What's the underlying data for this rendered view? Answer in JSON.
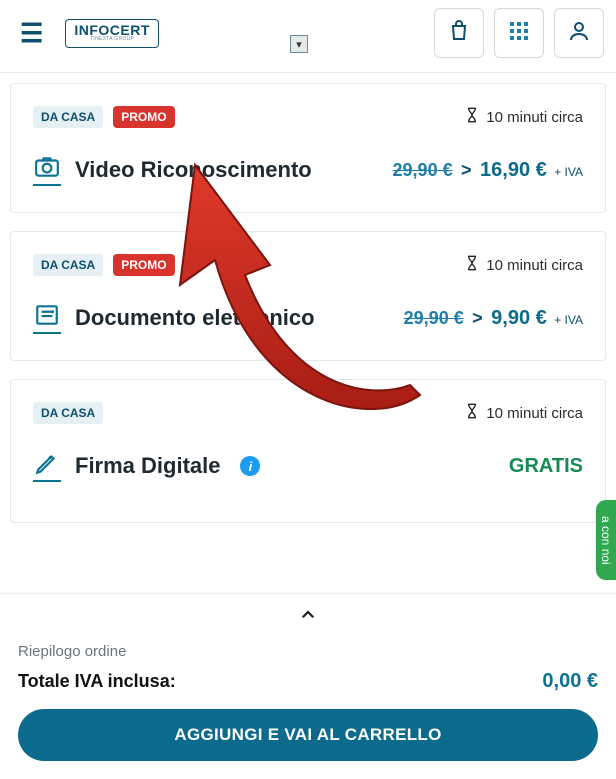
{
  "header": {
    "logo_main": "INFOCERT",
    "logo_sub": "TINEXTA GROUP"
  },
  "cards": [
    {
      "source": "DA CASA",
      "promo": "PROMO",
      "time": "10 minuti circa",
      "title": "Video Riconoscimento",
      "price_old": "29,90 €",
      "price_sep": ">",
      "price_new": "16,90 €",
      "vat": "+ IVA"
    },
    {
      "source": "DA CASA",
      "promo": "PROMO",
      "time": "10 minuti circa",
      "title": "Documento elettronico",
      "price_old": "29,90 €",
      "price_sep": ">",
      "price_new": "9,90 €",
      "vat": "+ IVA"
    },
    {
      "source": "DA CASA",
      "time": "10 minuti circa",
      "title": "Firma Digitale",
      "info": "i",
      "price_free": "GRATIS"
    }
  ],
  "sheet": {
    "summary": "Riepilogo ordine",
    "total_label": "Totale IVA inclusa:",
    "total_value": "0,00 €",
    "cta": "AGGIUNGI E VAI AL CARRELLO"
  },
  "colors": {
    "brand": "#0c6a8c",
    "promo": "#d9332e",
    "free": "#158a53"
  }
}
